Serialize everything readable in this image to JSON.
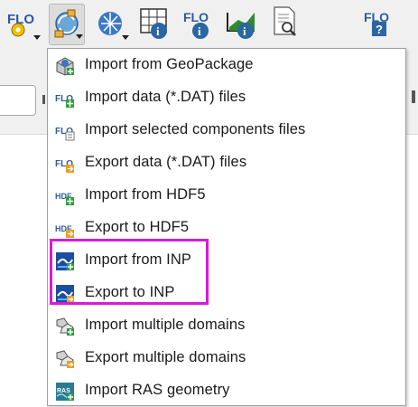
{
  "toolbar": {
    "buttons": [
      {
        "icon": "flo2d-settings-icon",
        "has_dropdown": true
      },
      {
        "icon": "import-export-icon",
        "has_dropdown": true,
        "pressed": true
      },
      {
        "icon": "grid-tools-icon",
        "has_dropdown": true
      },
      {
        "icon": "grid-info-icon",
        "has_dropdown": false
      },
      {
        "icon": "flo2d-info-icon",
        "has_dropdown": false
      },
      {
        "icon": "profile-info-icon",
        "has_dropdown": false
      },
      {
        "icon": "report-search-icon",
        "has_dropdown": false
      },
      {
        "icon": "flo2d-help-icon",
        "has_dropdown": false
      }
    ],
    "icon_text": "FLO"
  },
  "menu": {
    "items": [
      {
        "label": "Import from GeoPackage",
        "icon": "geopackage-import-icon"
      },
      {
        "label": "Import data (*.DAT) files",
        "icon": "flo-import-dat-icon"
      },
      {
        "label": "Import selected components files",
        "icon": "flo-import-components-icon"
      },
      {
        "label": "Export data (*.DAT) files",
        "icon": "flo-export-dat-icon"
      },
      {
        "label": "Import from HDF5",
        "icon": "hdf5-import-icon"
      },
      {
        "label": "Export to HDF5",
        "icon": "hdf5-export-icon"
      },
      {
        "label": "Import from INP",
        "icon": "inp-import-icon"
      },
      {
        "label": "Export to INP",
        "icon": "inp-export-icon"
      },
      {
        "label": "Import multiple domains",
        "icon": "multi-domain-import-icon"
      },
      {
        "label": "Export multiple domains",
        "icon": "multi-domain-export-icon"
      },
      {
        "label": "Import RAS geometry",
        "icon": "ras-geometry-import-icon"
      }
    ],
    "hdf_text": "HDF",
    "ras_text": "RAS"
  },
  "colors": {
    "highlight": "#d81bd8",
    "flo_blue": "#2a5aa0",
    "menu_border": "#a0a0a0"
  }
}
